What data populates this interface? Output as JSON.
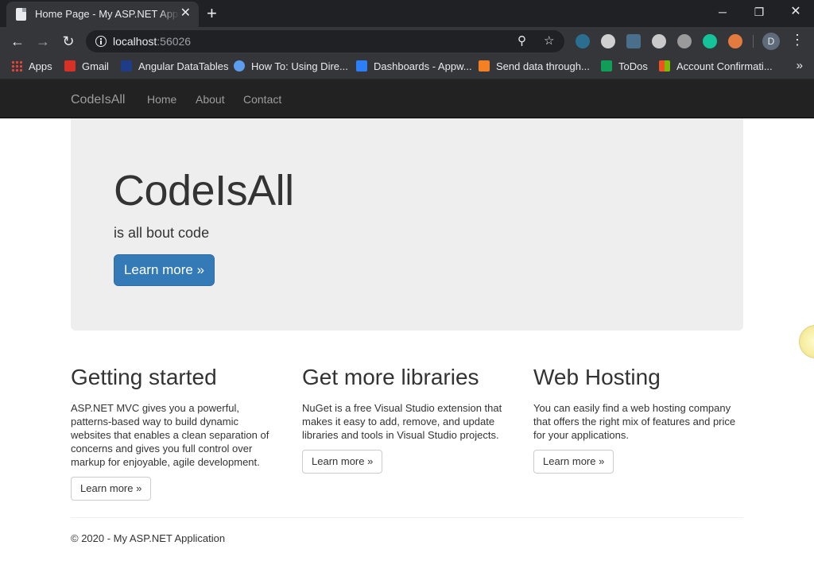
{
  "browser": {
    "tab_title": "Home Page - My ASP.NET Application",
    "close_tab": "✕",
    "new_tab": "+",
    "url_host": "localhost",
    "url_port": ":56026",
    "profile_initial": "D",
    "bookmarks": [
      {
        "label": "Apps",
        "icon": "apps-grid-icon"
      },
      {
        "label": "Gmail",
        "icon": "gmail-icon",
        "color": "#d93025"
      },
      {
        "label": "Angular DataTables",
        "icon": "angular-datatables-icon",
        "color": "#1f3c88"
      },
      {
        "label": "How To: Using Dire...",
        "icon": "howto-icon",
        "color": "#5c9ded"
      },
      {
        "label": "Dashboards - Appw...",
        "icon": "appwrite-icon",
        "color": "#2d7ff9"
      },
      {
        "label": "Send data through...",
        "icon": "stackoverflow-icon",
        "color": "#f48024"
      },
      {
        "label": "ToDos",
        "icon": "todos-icon",
        "color": "#0f9d58"
      },
      {
        "label": "Account Confirmati...",
        "icon": "microsoft-icon",
        "color": "#f25022"
      }
    ]
  },
  "navbar": {
    "brand": "CodeIsAll",
    "links": [
      "Home",
      "About",
      "Contact"
    ]
  },
  "jumbotron": {
    "title": "CodeIsAll",
    "lead": "is all bout code",
    "button": "Learn more »"
  },
  "columns": [
    {
      "heading": "Getting started",
      "text": "ASP.NET MVC gives you a powerful, patterns-based way to build dynamic websites that enables a clean separation of concerns and gives you full control over markup for enjoyable, agile development.",
      "button": "Learn more »"
    },
    {
      "heading": "Get more libraries",
      "text": "NuGet is a free Visual Studio extension that makes it easy to add, remove, and update libraries and tools in Visual Studio projects.",
      "button": "Learn more »"
    },
    {
      "heading": "Web Hosting",
      "text": "You can easily find a web hosting company that offers the right mix of features and price for your applications.",
      "button": "Learn more »"
    }
  ],
  "footer": "© 2020 - My ASP.NET Application",
  "colors": {
    "navbar_bg": "#222222",
    "jumbotron_bg": "#eeeeee",
    "primary": "#337ab7"
  }
}
